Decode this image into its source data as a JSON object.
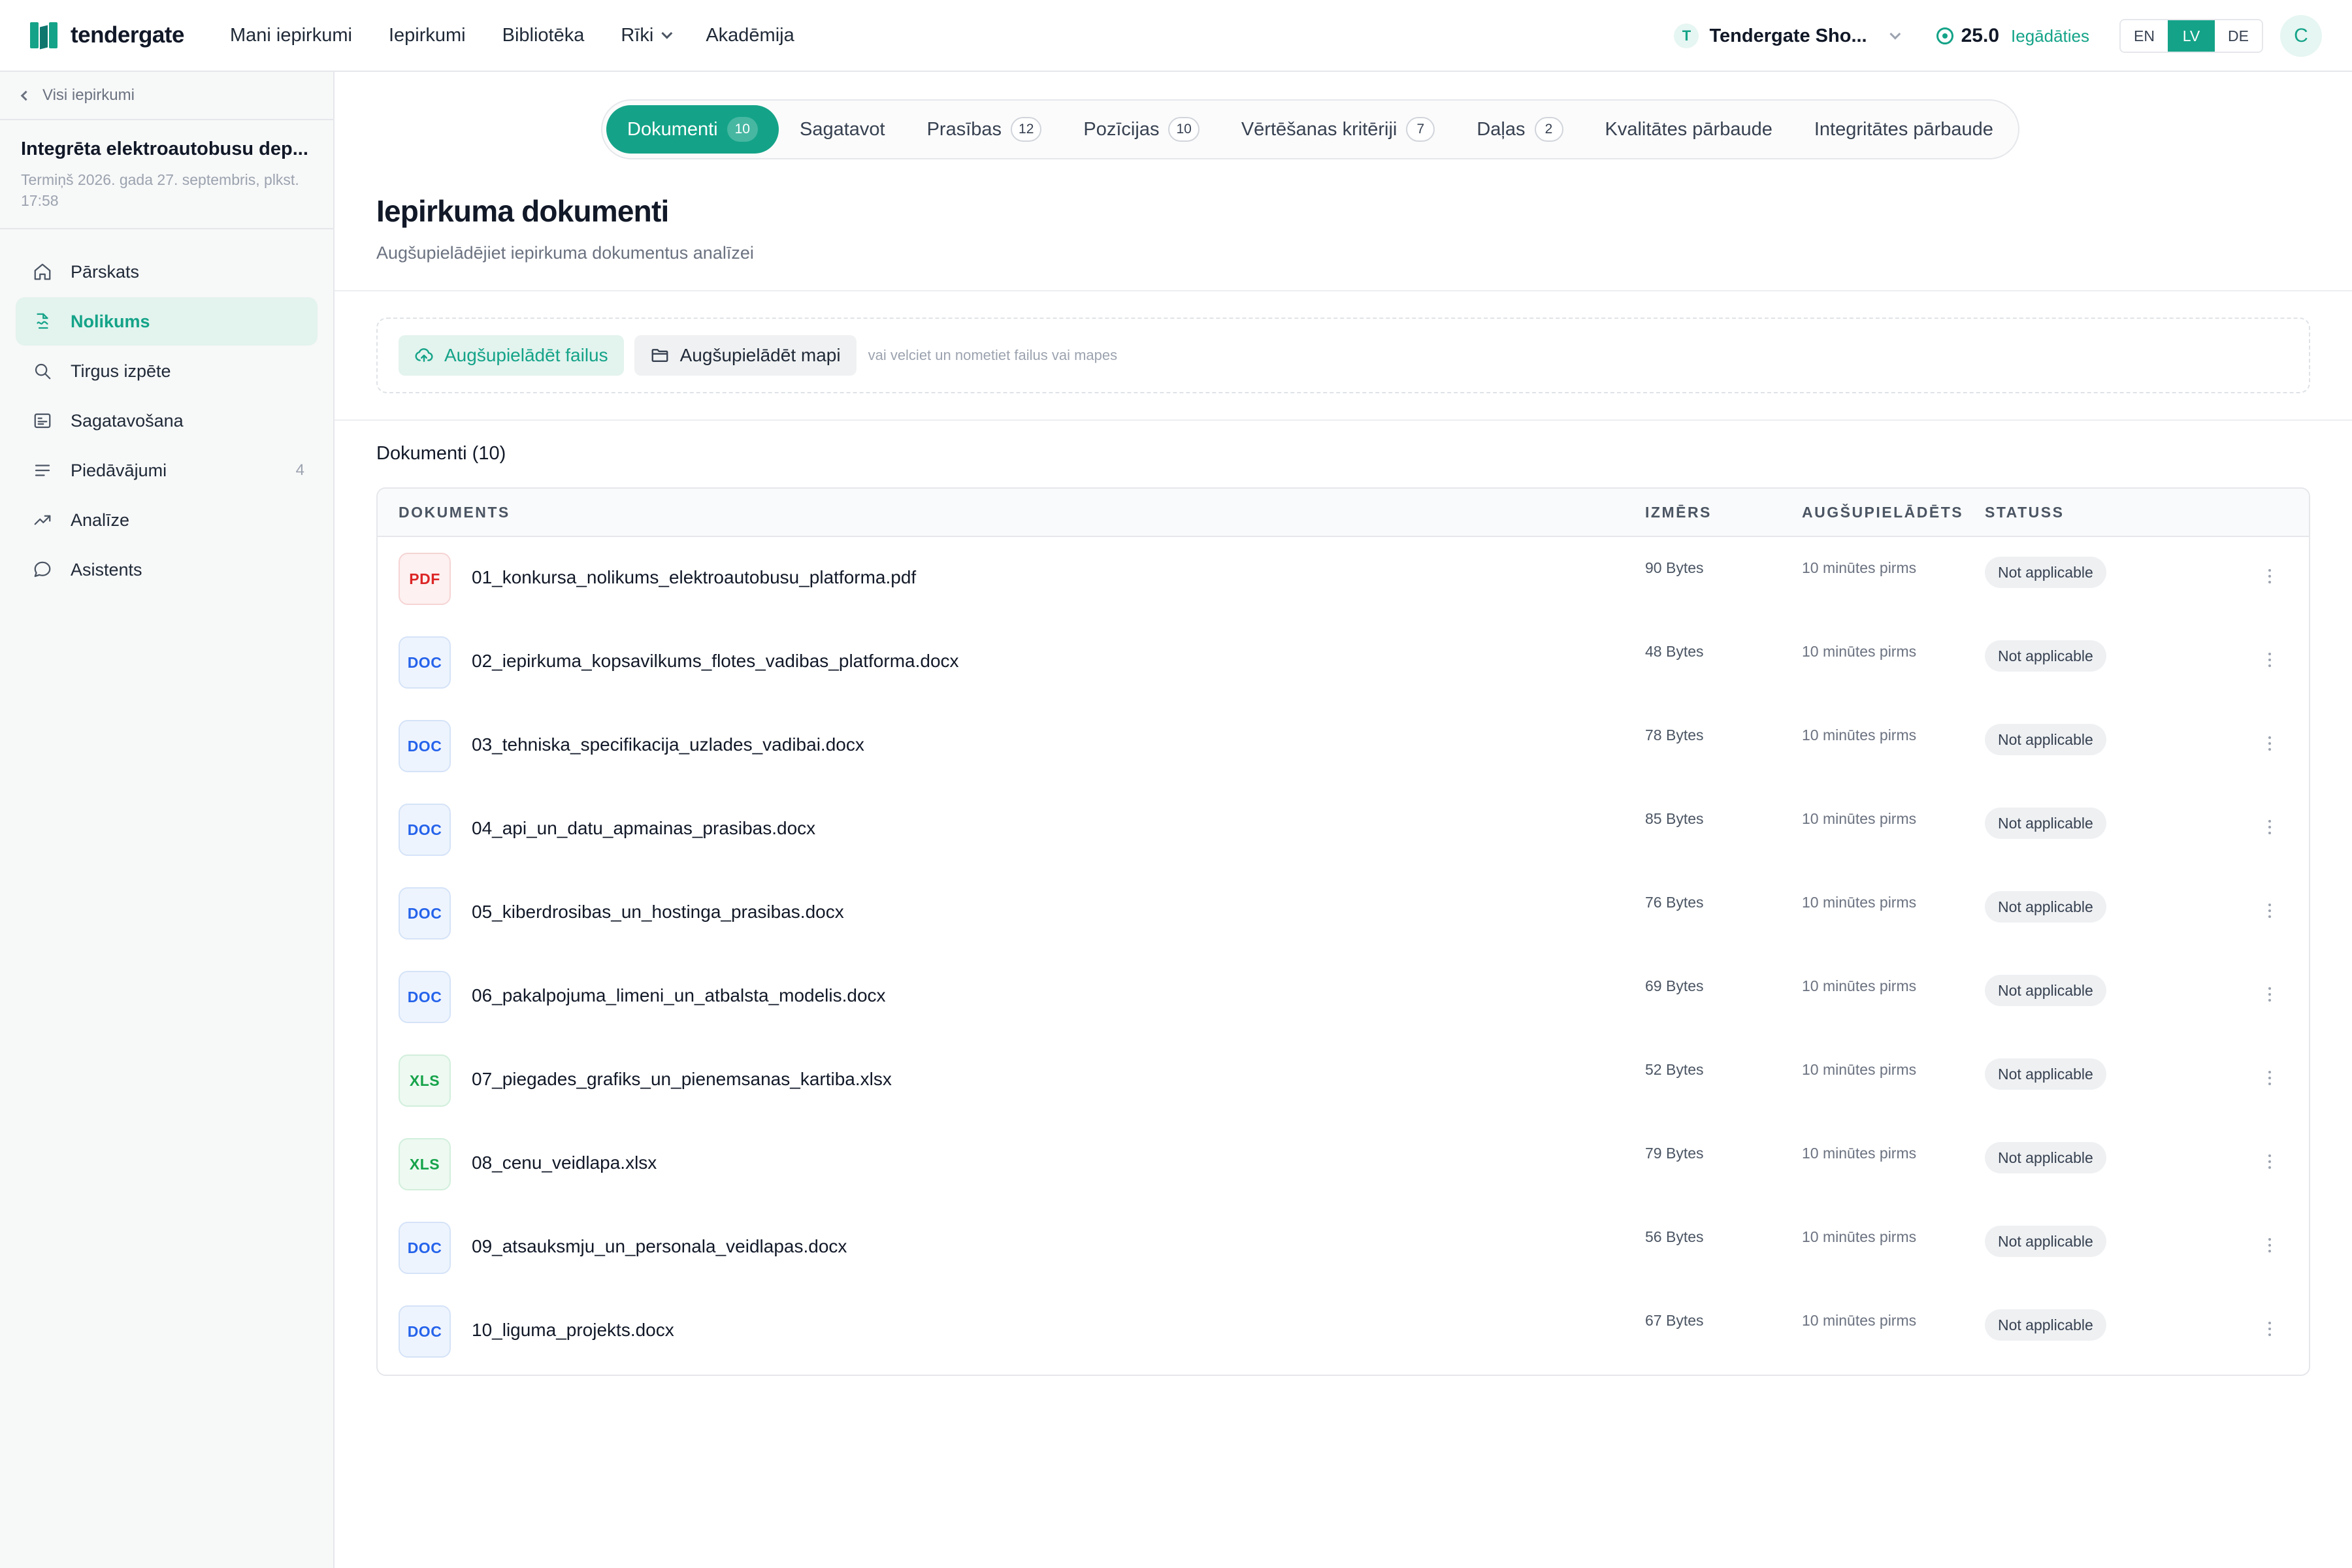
{
  "brand": {
    "name": "tendergate"
  },
  "topnav": [
    {
      "label": "Mani iepirkumi"
    },
    {
      "label": "Iepirkumi"
    },
    {
      "label": "Bibliotēka"
    },
    {
      "label": "Rīki"
    },
    {
      "label": "Akadēmija"
    }
  ],
  "workspace": {
    "initial": "T",
    "name": "Tendergate Sho..."
  },
  "credits": {
    "value": "25.0",
    "action": "Iegādāties"
  },
  "languages": {
    "en": "EN",
    "lv": "LV",
    "de": "DE",
    "active": "LV"
  },
  "user": {
    "initial": "C"
  },
  "sidebar": {
    "back_label": "Visi iepirkumi",
    "project_title": "Integrēta elektroautobusu dep...",
    "project_deadline": "Termiņš 2026. gada 27. septembris, plkst. 17:58",
    "items": [
      {
        "label": "Pārskats",
        "icon": "home-icon"
      },
      {
        "label": "Nolikums",
        "icon": "file-signature-icon",
        "active": true
      },
      {
        "label": "Tirgus izpēte",
        "icon": "search-icon"
      },
      {
        "label": "Sagatavošana",
        "icon": "list-box-icon"
      },
      {
        "label": "Piedāvājumi",
        "icon": "lines-icon",
        "count": "4"
      },
      {
        "label": "Analīze",
        "icon": "trend-up-icon"
      },
      {
        "label": "Asistents",
        "icon": "chat-bubble-icon"
      }
    ]
  },
  "tabs": [
    {
      "label": "Dokumenti",
      "count": "10",
      "active": true
    },
    {
      "label": "Sagatavot"
    },
    {
      "label": "Prasības",
      "count": "12"
    },
    {
      "label": "Pozīcijas",
      "count": "10"
    },
    {
      "label": "Vērtēšanas kritēriji",
      "count": "7"
    },
    {
      "label": "Daļas",
      "count": "2"
    },
    {
      "label": "Kvalitātes pārbaude"
    },
    {
      "label": "Integritātes pārbaude"
    }
  ],
  "page": {
    "title": "Iepirkuma dokumenti",
    "subtitle": "Augšupielādējiet iepirkuma dokumentus analīzei"
  },
  "upload": {
    "files_label": "Augšupielādēt failus",
    "folder_label": "Augšupielādēt mapi",
    "hint": "vai velciet un nometiet failus vai mapes"
  },
  "documents": {
    "heading": "Dokumenti (10)",
    "columns": {
      "name": "DOKUMENTS",
      "size": "IZMĒRS",
      "uploaded": "AUGŠUPIELĀDĒTS",
      "status": "STATUSS"
    },
    "rows": [
      {
        "type": "PDF",
        "name": "01_konkursa_nolikums_elektroautobusu_platforma.pdf",
        "size": "90 Bytes",
        "uploaded": "10 minūtes pirms",
        "status": "Not applicable"
      },
      {
        "type": "DOC",
        "name": "02_iepirkuma_kopsavilkums_flotes_vadibas_platforma.docx",
        "size": "48 Bytes",
        "uploaded": "10 minūtes pirms",
        "status": "Not applicable"
      },
      {
        "type": "DOC",
        "name": "03_tehniska_specifikacija_uzlades_vadibai.docx",
        "size": "78 Bytes",
        "uploaded": "10 minūtes pirms",
        "status": "Not applicable"
      },
      {
        "type": "DOC",
        "name": "04_api_un_datu_apmainas_prasibas.docx",
        "size": "85 Bytes",
        "uploaded": "10 minūtes pirms",
        "status": "Not applicable"
      },
      {
        "type": "DOC",
        "name": "05_kiberdrosibas_un_hostinga_prasibas.docx",
        "size": "76 Bytes",
        "uploaded": "10 minūtes pirms",
        "status": "Not applicable"
      },
      {
        "type": "DOC",
        "name": "06_pakalpojuma_limeni_un_atbalsta_modelis.docx",
        "size": "69 Bytes",
        "uploaded": "10 minūtes pirms",
        "status": "Not applicable"
      },
      {
        "type": "XLS",
        "name": "07_piegades_grafiks_un_pienemsanas_kartiba.xlsx",
        "size": "52 Bytes",
        "uploaded": "10 minūtes pirms",
        "status": "Not applicable"
      },
      {
        "type": "XLS",
        "name": "08_cenu_veidlapa.xlsx",
        "size": "79 Bytes",
        "uploaded": "10 minūtes pirms",
        "status": "Not applicable"
      },
      {
        "type": "DOC",
        "name": "09_atsauksmju_un_personala_veidlapas.docx",
        "size": "56 Bytes",
        "uploaded": "10 minūtes pirms",
        "status": "Not applicable"
      },
      {
        "type": "DOC",
        "name": "10_liguma_projekts.docx",
        "size": "67 Bytes",
        "uploaded": "10 minūtes pirms",
        "status": "Not applicable"
      }
    ]
  },
  "colors": {
    "accent": "#14a388",
    "accent_light": "#e3f3ee",
    "pdf": "#dc2626",
    "doc": "#2563eb",
    "xls": "#16a34a"
  }
}
